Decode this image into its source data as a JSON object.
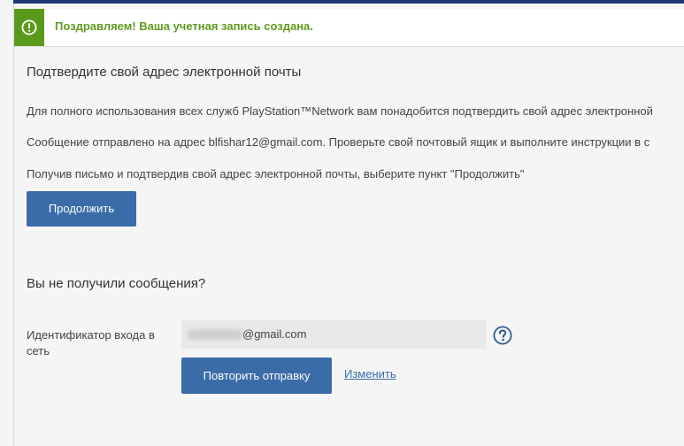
{
  "alert": {
    "icon": "exclamation-circle-icon",
    "text": "Поздравляем! Ваша учетная запись создана.",
    "color": "#5f9b20",
    "icon_bg": "#5a9a1a"
  },
  "verify": {
    "heading": "Подтвердите свой адрес электронной почты",
    "para1": "Для полного использования всех служб PlayStation™Network вам понадобится подтвердить свой адрес электронной",
    "para2": "Сообщение отправлено на адрес blfishar12@gmail.com. Проверьте свой почтовый ящик и выполните инструкции в с",
    "para3": "Получив письмо и подтвердив свой адрес электронной почты, выберите пункт \"Продолжить\"",
    "continue_label": "Продолжить"
  },
  "resend": {
    "heading": "Вы не получили сообщения?",
    "field_label": "Идентификатор входа в сеть",
    "field_value_suffix": "@gmail.com",
    "help_icon": "question-circle-icon",
    "resend_label": "Повторить отправку",
    "change_label": "Изменить"
  },
  "colors": {
    "button": "#3a6ca8",
    "link": "#3a6ca8",
    "top_rule": "#1f3a73"
  }
}
